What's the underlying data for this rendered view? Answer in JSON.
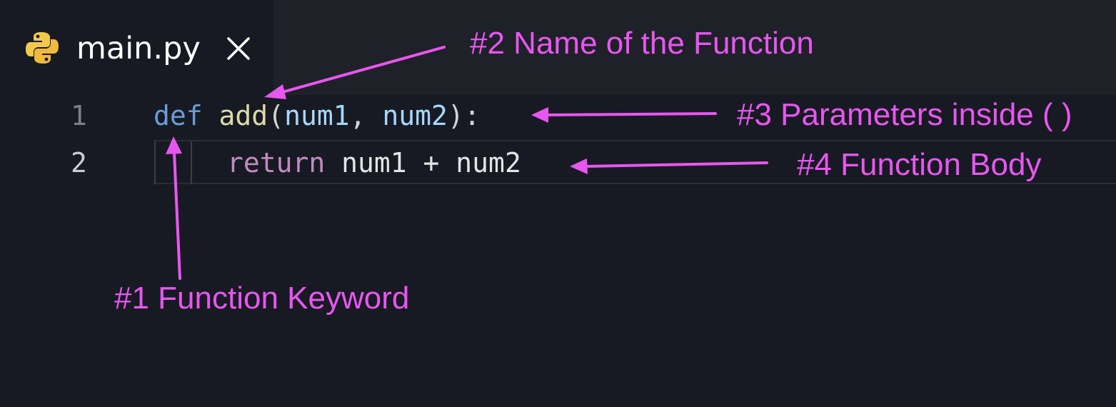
{
  "tab": {
    "title": "main.py",
    "icon": "python-icon",
    "close_icon": "close-icon"
  },
  "editor": {
    "lines": [
      {
        "number": "1",
        "tokens": {
          "keyword": "def",
          "space1": " ",
          "name": "add",
          "open": "(",
          "param1": "num1",
          "comma": ", ",
          "param2": "num2",
          "close": "):"
        }
      },
      {
        "number": "2",
        "tokens": {
          "keyword": "return",
          "rest": " num1 + num2"
        }
      }
    ]
  },
  "annotations": {
    "function_keyword": "#1 Function Keyword",
    "function_name": "#2 Name of the Function",
    "parameters": "#3 Parameters inside ( )",
    "function_body": "#4 Function Body"
  },
  "colors": {
    "annotation": "#e856f0",
    "keyword_def": "#6a9cd6",
    "function_name": "#dcdba8",
    "parameter": "#a6d7fb",
    "keyword_return": "#c18bc0",
    "background": "#171a22"
  }
}
